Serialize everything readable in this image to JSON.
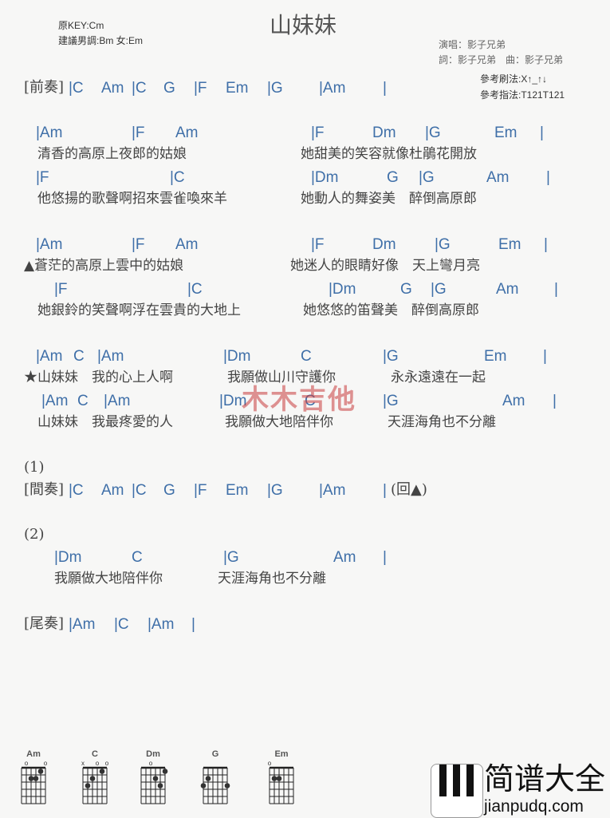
{
  "header": {
    "title": "山妹妹",
    "key": "原KEY:Cm",
    "suggest": "建議男調:Bm 女:Em",
    "singer": "演唱：影子兄弟",
    "credits": "詞：影子兄弟　曲：影子兄弟",
    "strum": "參考刷法:X↑_↑↓",
    "finger": "參考指法:T121T121"
  },
  "intro": {
    "tag": "[前奏]",
    "chords": [
      "|C",
      "Am",
      "|C",
      "G",
      "|F",
      "Em",
      "|G",
      "|Am",
      "|"
    ]
  },
  "v1": {
    "c1": [
      "|Am",
      "|F",
      "Am",
      "|F",
      "Dm",
      "|G",
      "Em",
      "|"
    ],
    "l1": [
      "清香的高原上夜郎的姑娘",
      "她甜美的笑容就像杜鵑花開放"
    ],
    "c2": [
      "|F",
      "|C",
      "|Dm",
      "G",
      "|G",
      "Am",
      "|"
    ],
    "l2": [
      "他悠揚的歌聲啊招來雲雀喚來羊",
      "她動人的舞姿美　醉倒高原郎"
    ]
  },
  "v2": {
    "c1": [
      "|Am",
      "|F",
      "Am",
      "|F",
      "Dm",
      "|G",
      "Em",
      "|"
    ],
    "l1": [
      "▲蒼茫的高原上雲中的姑娘",
      "她迷人的眼睛好像　天上彎月亮"
    ],
    "c2": [
      "|F",
      "|C",
      "|Dm",
      "G",
      "|G",
      "Am",
      "|"
    ],
    "l2": [
      "她銀鈴的笑聲啊浮在雲貴的大地上",
      "她悠悠的笛聲美　醉倒高原郎"
    ]
  },
  "chorus": {
    "c1": [
      "|Am",
      "C",
      "|Am",
      "|Dm",
      "C",
      "|G",
      "Em",
      "|"
    ],
    "l1": [
      "★山妹妹　我的心上人啊",
      "我願做山川守護你",
      "永永遠遠在一起"
    ],
    "c2": [
      "|Am",
      "C",
      "|Am",
      "|Dm",
      "C",
      "|G",
      "Am",
      "|"
    ],
    "l2": [
      "山妹妹　我最疼愛的人",
      "我願做大地陪伴你",
      "天涯海角也不分離"
    ]
  },
  "part1": {
    "label": "(1)",
    "tag": "[間奏]",
    "chords": [
      "|C",
      "Am",
      "|C",
      "G",
      "|F",
      "Em",
      "|G",
      "|Am",
      "|"
    ],
    "back": "(回▲)"
  },
  "part2": {
    "label": "(2)",
    "chords": [
      "|Dm",
      "C",
      "|G",
      "Am",
      "|"
    ],
    "lyrics": [
      "我願做大地陪伴你",
      "天涯海角也不分離"
    ]
  },
  "outro": {
    "tag": "[尾奏]",
    "chords": [
      "|Am",
      "|C",
      "|Am",
      "|"
    ]
  },
  "watermark": "木木吉他",
  "logo": {
    "name": "简谱大全",
    "url": "jianpudq.com"
  },
  "chord_diagrams": [
    {
      "name": "Am",
      "marks": [
        "",
        "o",
        "",
        "",
        "",
        "o"
      ],
      "dots": [
        [
          4,
          2
        ],
        [
          3,
          2
        ],
        [
          2,
          1
        ]
      ]
    },
    {
      "name": "C",
      "marks": [
        "x",
        "",
        "",
        "o",
        "",
        "o"
      ],
      "dots": [
        [
          5,
          3
        ],
        [
          4,
          2
        ],
        [
          2,
          1
        ]
      ]
    },
    {
      "name": "Dm",
      "marks": [
        "",
        "",
        "o",
        "",
        "",
        ""
      ],
      "dots": [
        [
          3,
          2
        ],
        [
          2,
          3
        ],
        [
          1,
          1
        ]
      ]
    },
    {
      "name": "G",
      "marks": [
        "",
        "",
        "",
        "",
        "",
        ""
      ],
      "dots": [
        [
          6,
          3
        ],
        [
          5,
          2
        ],
        [
          1,
          3
        ]
      ]
    },
    {
      "name": "Em",
      "marks": [
        "o",
        "",
        "",
        "",
        "",
        ""
      ],
      "dots": [
        [
          5,
          2
        ],
        [
          4,
          2
        ]
      ]
    }
  ],
  "colors": {
    "chord": "#3f6fa8",
    "lyric": "#444444"
  }
}
